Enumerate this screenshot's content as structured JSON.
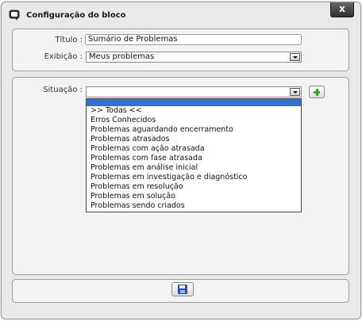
{
  "dialog": {
    "title": "Configuração do bloco",
    "close_label": "x"
  },
  "form": {
    "titulo_label": "Título :",
    "titulo_value": "Sumário de Problemas",
    "exibicao_label": "Exibição :",
    "exibicao_value": "Meus problemas",
    "situacao_label": "Situação :",
    "situacao_value": ""
  },
  "situacao_options": [
    ">> Todas <<",
    "Erros Conhecidos",
    "Problemas aguardando encerramento",
    "Problemas atrasados",
    "Problemas com ação atrasada",
    "Problemas com fase atrasada",
    "Problemas em análise inicial",
    "Problemas em investigação e diagnóstico",
    "Problemas em resolução",
    "Problemas em solução",
    "Problemas sendo criados"
  ],
  "icons": {
    "title": "chat-bubble-icon",
    "add": "plus-icon",
    "save": "floppy-disk-icon",
    "dropdown": "chevron-down-icon"
  },
  "colors": {
    "highlight": "#3270d8",
    "add_green": "#3aa52a",
    "save_blue": "#2452a6"
  }
}
